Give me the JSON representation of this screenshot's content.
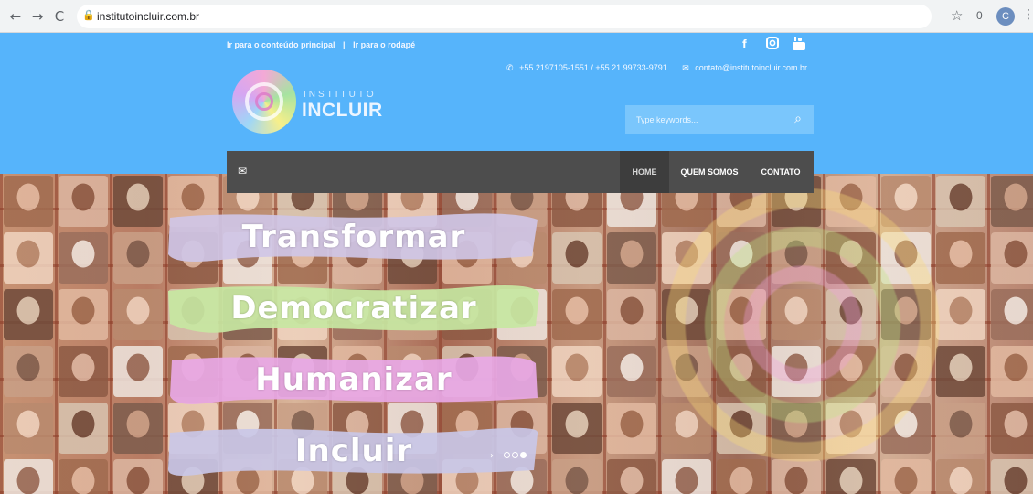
{
  "browser": {
    "back_icon": "←",
    "forward_icon": "→",
    "reload_icon": "C",
    "lock_icon": "lock-icon",
    "url": "institutoincluir.com.br",
    "star_icon": "☆",
    "counter": "0",
    "profile_initial": "C",
    "menu_icon": "⋮"
  },
  "header": {
    "skip_main": "Ir para o conteúdo principal",
    "skip_sep": "|",
    "skip_footer": "Ir para o rodapé",
    "social": {
      "facebook": "f",
      "instagram": "instagram-icon",
      "youtube": "youtube-icon"
    },
    "phone": "+55 2197105-1551 / +55 21 99733-9791",
    "email": "contato@institutoincluir.com.br",
    "logo_small": "INSTITUTO",
    "logo_big": "INCLUIR",
    "search_placeholder": "Type keywords..."
  },
  "nav": {
    "items": [
      "HOME",
      "QUEM SOMOS",
      "CONTATO"
    ]
  },
  "hero": {
    "words": [
      "Transformar",
      "Democratizar",
      "Humanizar",
      "Incluir"
    ],
    "brush_colors": [
      "#cfc6e6",
      "#c7e7a2",
      "#e8a8e6",
      "#c9c7e7"
    ],
    "slider_arrow": "›",
    "slider_dots": 3,
    "slider_active_index": 2
  },
  "colors": {
    "header_bg": "#56b4fb",
    "nav_bg": "#4d4d4d",
    "search_bg": "#7ac6fc"
  }
}
